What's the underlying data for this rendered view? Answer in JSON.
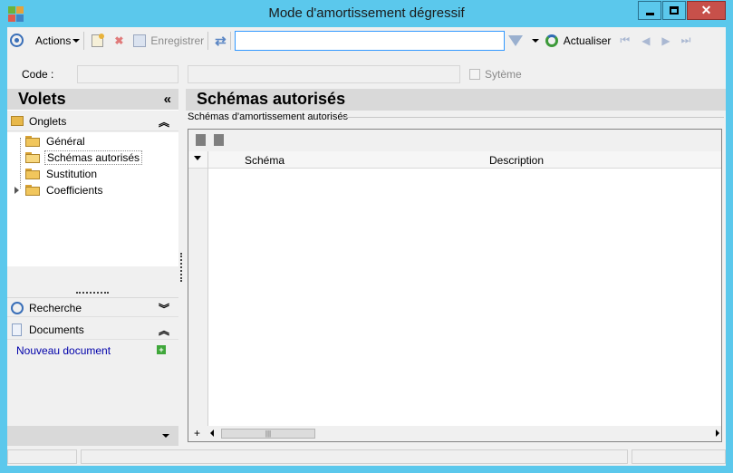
{
  "window": {
    "title": "Mode d'amortissement dégressif"
  },
  "toolbar": {
    "actions_label": "Actions",
    "save_label": "Enregistrer",
    "search_value": "",
    "refresh_label": "Actualiser"
  },
  "code_row": {
    "code_label": "Code :",
    "system_label": "Sytème"
  },
  "left_panel": {
    "title": "Volets",
    "tabs_group": {
      "label": "Onglets",
      "items": [
        {
          "label": "Général"
        },
        {
          "label": "Schémas autorisés",
          "selected": true
        },
        {
          "label": "Sustitution"
        },
        {
          "label": "Coefficients",
          "expandable": true
        }
      ]
    },
    "search_group": {
      "label": "Recherche"
    },
    "documents_group": {
      "label": "Documents",
      "new_document_label": "Nouveau document"
    }
  },
  "right_panel": {
    "title": "Schémas autorisés",
    "section_label": "Schémas d'amortissement autorisés",
    "columns": [
      "Schéma",
      "Description"
    ],
    "rows": []
  },
  "colors": {
    "titlebar": "#5bc8ec",
    "panel_header": "#d9d9d9",
    "close": "#c7504a",
    "link": "#0000aa"
  }
}
